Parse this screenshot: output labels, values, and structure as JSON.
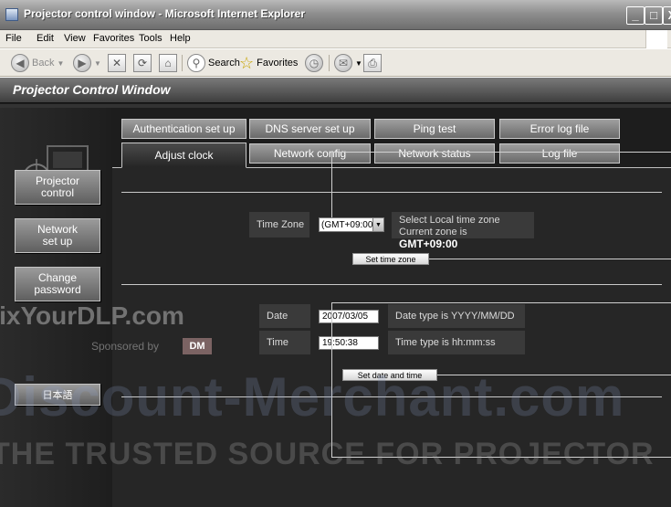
{
  "window": {
    "title": "Projector control window - Microsoft Internet Explorer",
    "controls": {
      "minimize": "_",
      "maximize": "□",
      "close": "X"
    }
  },
  "menubar": [
    "File",
    "Edit",
    "View",
    "Favorites",
    "Tools",
    "Help"
  ],
  "toolbar": {
    "back": "Back",
    "search": "Search",
    "favorites": "Favorites"
  },
  "page": {
    "title": "Projector Control Window",
    "sidebar": {
      "buttons": [
        "Projector\ncontrol",
        "Network\nset up",
        "Change\npassword"
      ],
      "language_button": "日本語"
    },
    "tabs_top": [
      "Authentication set up",
      "DNS server set up",
      "Ping test",
      "Error log file"
    ],
    "tabs_bottom": [
      "Adjust clock",
      "Network config",
      "Network status",
      "Log file"
    ],
    "timezone": {
      "label": "Time Zone",
      "value": "(GMT+09:00)",
      "info_line1": "Select Local time zone",
      "info_line2_prefix": "Current zone is",
      "current_zone": "GMT+09:00",
      "button": "Set time zone"
    },
    "datetime": {
      "date_label": "Date",
      "date_value": "2007/03/05",
      "date_hint": "Date type is YYYY/MM/DD",
      "time_label": "Time",
      "time_value": "19:50:38",
      "time_hint": "Time type is hh:mm:ss",
      "button": "Set date and time"
    }
  },
  "watermark": {
    "line1": "FixYourDLP.com",
    "line2": "Sponsored by",
    "line2_logo": "DM",
    "line3": "Discount-Merchant.com",
    "line4": "THE TRUSTED SOURCE FOR PROJECTOR"
  }
}
